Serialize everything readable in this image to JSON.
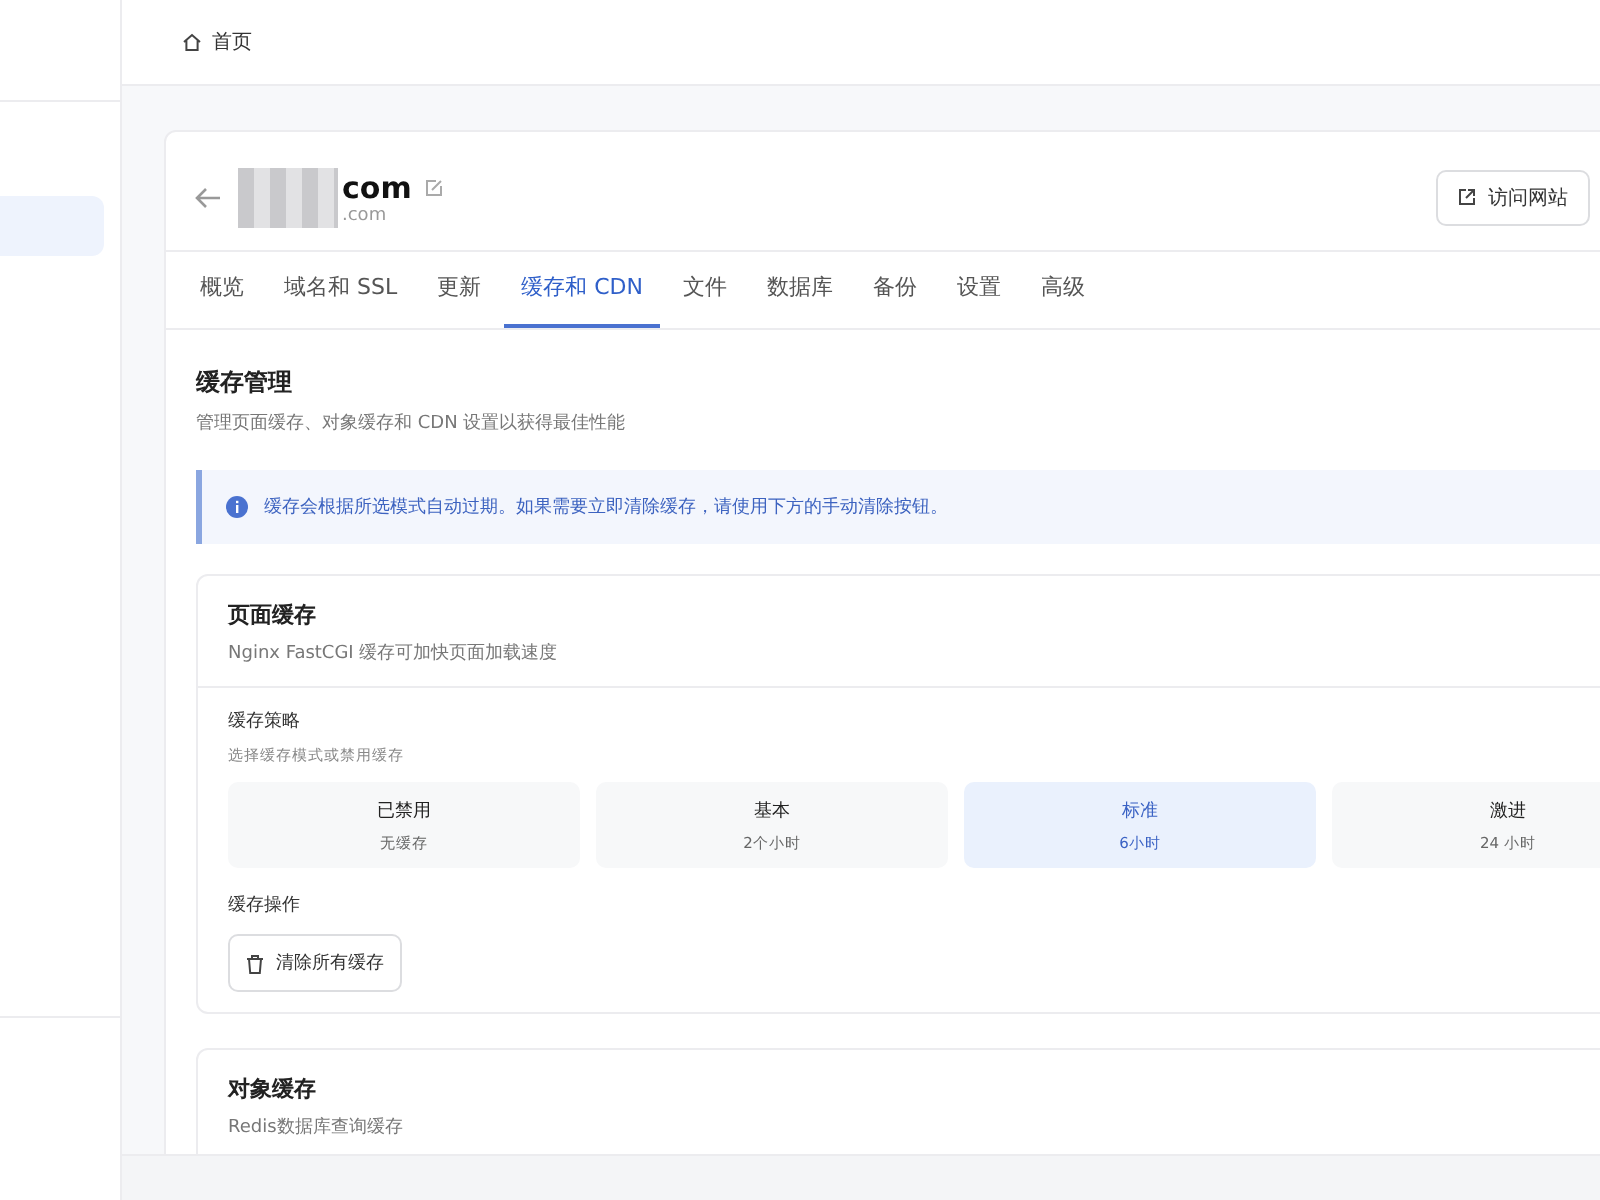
{
  "sidebar": {
    "items": [
      {
        "selected": true
      }
    ]
  },
  "breadcrumb": {
    "label": "首页"
  },
  "site": {
    "title": "com",
    "subtitle": ".com",
    "actions": [
      {
        "label": "访问网站"
      }
    ]
  },
  "tabs": [
    {
      "label": "概览",
      "selected": false
    },
    {
      "label": "域名和 SSL",
      "selected": false
    },
    {
      "label": "更新",
      "selected": false
    },
    {
      "label": "缓存和 CDN",
      "selected": true
    },
    {
      "label": "文件",
      "selected": false
    },
    {
      "label": "数据库",
      "selected": false
    },
    {
      "label": "备份",
      "selected": false
    },
    {
      "label": "设置",
      "selected": false
    },
    {
      "label": "高级",
      "selected": false
    }
  ],
  "section": {
    "title": "缓存管理",
    "description": "管理页面缓存、对象缓存和 CDN 设置以获得最佳性能"
  },
  "notice": {
    "text": "缓存会根据所选模式自动过期。如果需要立即清除缓存，请使用下方的手动清除按钮。"
  },
  "page_cache": {
    "title": "页面缓存",
    "description": "Nginx FastCGI 缓存可加快页面加载速度",
    "strategy_label": "缓存策略",
    "strategy_hint": "选择缓存模式或禁用缓存",
    "options": [
      {
        "label": "已禁用",
        "detail": "无缓存",
        "selected": false
      },
      {
        "label": "基本",
        "detail": "2个小时",
        "selected": false
      },
      {
        "label": "标准",
        "detail": "6小时",
        "selected": true
      },
      {
        "label": "激进",
        "detail": "24 小时",
        "selected": false
      }
    ],
    "actions_label": "缓存操作",
    "clear_button": "清除所有缓存"
  },
  "object_cache": {
    "title": "对象缓存",
    "description": "Redis数据库查询缓存"
  }
}
